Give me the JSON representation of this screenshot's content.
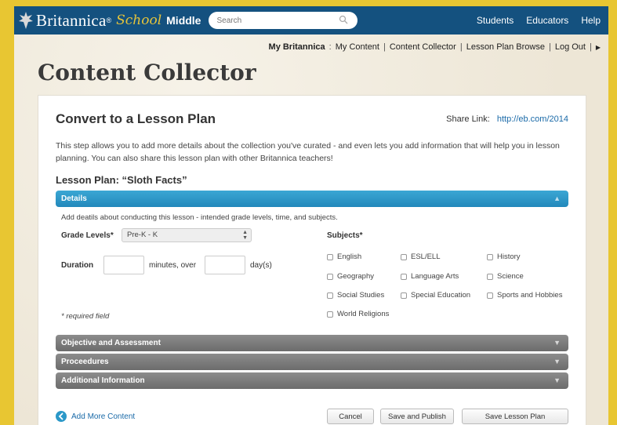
{
  "header": {
    "brand": "Britannica",
    "school": "School",
    "level": "Middle",
    "search_placeholder": "Search",
    "nav": [
      "Students",
      "Educators",
      "Help"
    ]
  },
  "subnav": {
    "label": "My Britannica",
    "links": [
      "My Content",
      "Content Collector",
      "Lesson Plan Browse",
      "Log Out"
    ]
  },
  "page_title": "Content Collector",
  "panel": {
    "title": "Convert to a Lesson Plan",
    "share_label": "Share Link:",
    "share_url": "http://eb.com/2014",
    "intro": "This step allows you to add more details about the collection you've curated - and even lets you add information that will help you in lesson planning. You can also share this lesson plan with other Britannica teachers!",
    "lesson_plan_title": "Lesson Plan: “Sloth Facts”"
  },
  "details": {
    "header": "Details",
    "description": "Add deatils about conducting this lesson - intended grade levels, time, and subjects.",
    "grade_label": "Grade Levels*",
    "grade_value": "Pre-K - K",
    "duration_label": "Duration",
    "minutes_text": "minutes, over",
    "days_text": "day(s)",
    "required_note": "* required field",
    "subjects_label": "Subjects*",
    "subjects": [
      [
        "English",
        "ESL/ELL",
        "History"
      ],
      [
        "Geography",
        "Language Arts",
        "Science"
      ],
      [
        "Social Studies",
        "Special Education",
        "Sports and Hobbies"
      ],
      [
        "World Religions"
      ]
    ]
  },
  "sections": [
    "Objective and Assessment",
    "Proceedures",
    "Additional Information"
  ],
  "footer": {
    "add_more": "Add More Content",
    "cancel": "Cancel",
    "save_publish": "Save and Publish",
    "save_plan": "Save Lesson Plan"
  },
  "colors": {
    "topbar": "#14517f",
    "accent_blue": "#2b98c8",
    "outer_yellow": "#e8c632",
    "link": "#1a6aa8"
  }
}
